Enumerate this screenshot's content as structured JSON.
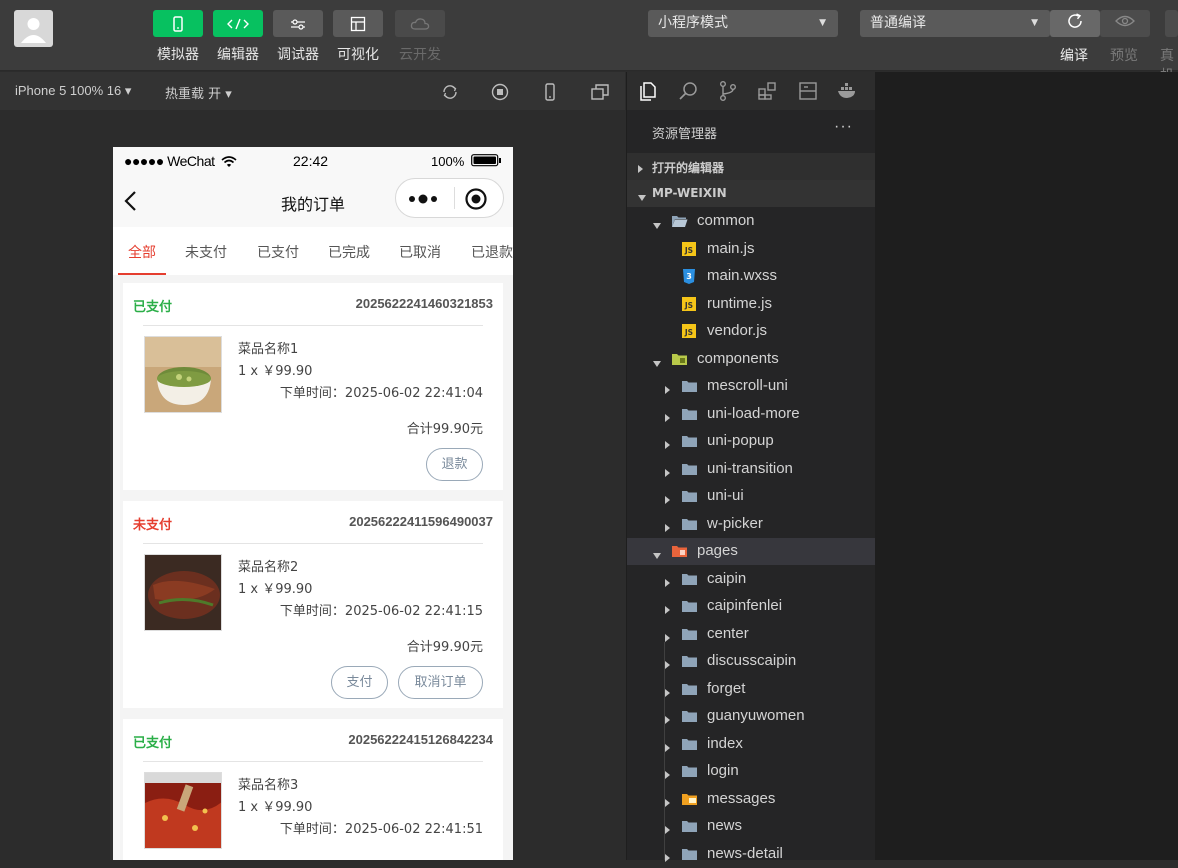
{
  "toolbar": {
    "tools": [
      {
        "label": "模拟器",
        "icon": "phone-icon"
      },
      {
        "label": "编辑器",
        "icon": "code-icon"
      },
      {
        "label": "调试器",
        "icon": "debug-icon"
      },
      {
        "label": "可视化",
        "icon": "layout-icon"
      },
      {
        "label": "云开发",
        "icon": "cloud-icon"
      }
    ],
    "mode_select": "小程序模式",
    "compile_select": "普通编译",
    "compile_label": "编译",
    "preview_label": "预览",
    "realdevice_label": "真机"
  },
  "simulator_bar": {
    "device": "iPhone 5 100% 16 ▾",
    "hot_reload": "热重载 开 ▾"
  },
  "phone": {
    "status": {
      "carrier": "●●●●● WeChat",
      "time": "22:42",
      "battery": "100%"
    },
    "nav_title": "我的订单",
    "tabs": [
      "全部",
      "未支付",
      "已支付",
      "已完成",
      "已取消",
      "已退款"
    ],
    "orders": [
      {
        "status": "已支付",
        "status_color": "#2bae48",
        "order_no": "2025622241460321853",
        "name": "菜品名称1",
        "qty_price": "1 x ￥99.90",
        "time": "下单时间：2025-06-02 22:41:04",
        "total": "合计99.90元",
        "buttons": [
          "退款"
        ]
      },
      {
        "status": "未支付",
        "status_color": "#e53e2f",
        "order_no": "2025622241159649003​7",
        "name": "菜品名称2",
        "qty_price": "1 x ￥99.90",
        "time": "下单时间：2025-06-02 22:41:15",
        "total": "合计99.90元",
        "buttons": [
          "支付",
          "取消订单"
        ]
      },
      {
        "status": "已支付",
        "status_color": "#2bae48",
        "order_no": "2025622241512684223​4",
        "name": "菜品名称3",
        "qty_price": "1 x ￥99.90",
        "time": "下单时间：2025-06-02 22:41:51",
        "total": "",
        "buttons": []
      }
    ]
  },
  "explorer": {
    "title": "资源管理器",
    "more": "···",
    "open_editors": "打开的编辑器",
    "project": "MP-WEIXIN",
    "tree": [
      {
        "name": "common",
        "type": "folder-open",
        "depth": 0,
        "expanded": true
      },
      {
        "name": "main.js",
        "type": "js",
        "depth": 1
      },
      {
        "name": "main.wxss",
        "type": "css",
        "depth": 1
      },
      {
        "name": "runtime.js",
        "type": "js",
        "depth": 1
      },
      {
        "name": "vendor.js",
        "type": "js",
        "depth": 1
      },
      {
        "name": "components",
        "type": "folder-components",
        "depth": 0,
        "expanded": true
      },
      {
        "name": "mescroll-uni",
        "type": "folder",
        "depth": 1
      },
      {
        "name": "uni-load-more",
        "type": "folder",
        "depth": 1
      },
      {
        "name": "uni-popup",
        "type": "folder",
        "depth": 1
      },
      {
        "name": "uni-transition",
        "type": "folder",
        "depth": 1
      },
      {
        "name": "uni-ui",
        "type": "folder",
        "depth": 1
      },
      {
        "name": "w-picker",
        "type": "folder",
        "depth": 1
      },
      {
        "name": "pages",
        "type": "folder-pages",
        "depth": 0,
        "expanded": true
      },
      {
        "name": "caipin",
        "type": "folder",
        "depth": 1
      },
      {
        "name": "caipinfenlei",
        "type": "folder",
        "depth": 1
      },
      {
        "name": "center",
        "type": "folder",
        "depth": 1
      },
      {
        "name": "discusscaipin",
        "type": "folder",
        "depth": 1
      },
      {
        "name": "forget",
        "type": "folder",
        "depth": 1
      },
      {
        "name": "guanyuwomen",
        "type": "folder",
        "depth": 1
      },
      {
        "name": "index",
        "type": "folder",
        "depth": 1
      },
      {
        "name": "login",
        "type": "folder",
        "depth": 1
      },
      {
        "name": "messages",
        "type": "folder-messages",
        "depth": 1
      },
      {
        "name": "news",
        "type": "folder",
        "depth": 1
      },
      {
        "name": "news-detail",
        "type": "folder",
        "depth": 1
      }
    ]
  }
}
